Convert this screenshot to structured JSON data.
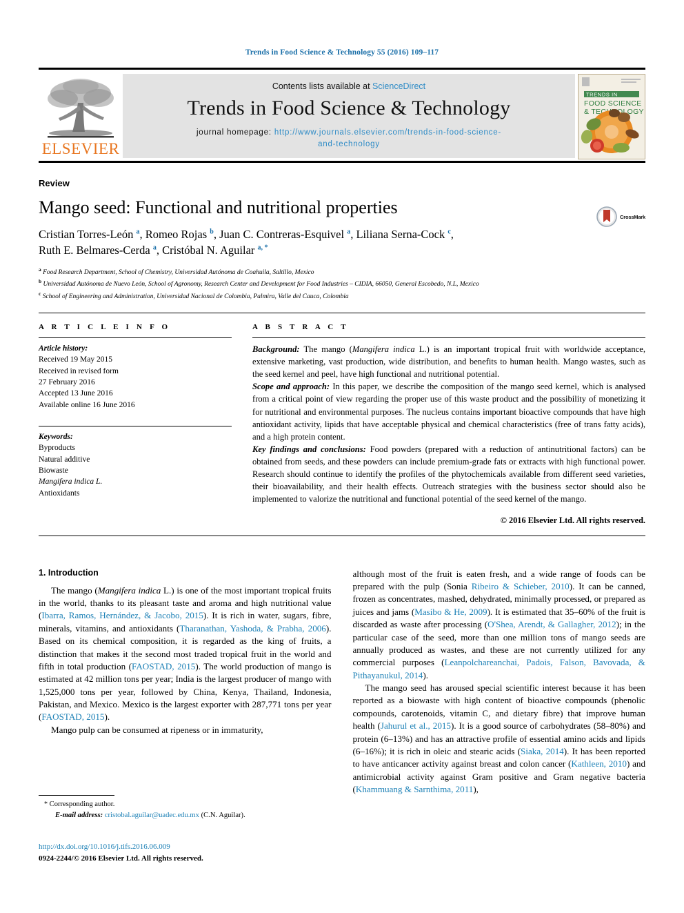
{
  "running_head": "Trends in Food Science & Technology 55 (2016) 109–117",
  "masthead": {
    "contents_prefix": "Contents lists available at ",
    "sciencedirect_link": "ScienceDirect",
    "journal_title": "Trends in Food Science & Technology",
    "homepage_label": "journal homepage: ",
    "homepage_url_line1": "http://www.journals.elsevier.com/trends-in-food-science-",
    "homepage_url_line2": "and-technology",
    "publisher_logo_text": "ELSEVIER",
    "cover_title_line1": "TRENDS IN",
    "cover_title_line2": "FOOD SCIENCE",
    "cover_title_line3": "& TECHNOLOGY",
    "link_color": "#2e8bc6"
  },
  "article": {
    "doctype": "Review",
    "title": "Mango seed: Functional and nutritional properties",
    "crossmark_label": "CrossMark",
    "authors_line1": "Cristian Torres-León a, Romeo Rojas b, Juan C. Contreras-Esquivel a, Liliana Serna-Cock c,",
    "authors_line2": "Ruth E. Belmares-Cerda a, Cristóbal N. Aguilar a, *",
    "authors": [
      {
        "name": "Cristian Torres-León",
        "sup": "a"
      },
      {
        "name": "Romeo Rojas",
        "sup": "b"
      },
      {
        "name": "Juan C. Contreras-Esquivel",
        "sup": "a"
      },
      {
        "name": "Liliana Serna-Cock",
        "sup": "c"
      },
      {
        "name": "Ruth E. Belmares-Cerda",
        "sup": "a"
      },
      {
        "name": "Cristóbal N. Aguilar",
        "sup": "a, *"
      }
    ],
    "affiliations": [
      {
        "sup": "a",
        "text": "Food Research Department, School of Chemistry, Universidad Autónoma de Coahuila, Saltillo, Mexico"
      },
      {
        "sup": "b",
        "text": "Universidad Autónoma de Nuevo León, School of Agronomy, Research Center and Development for Food Industries – CIDIA, 66050, General Escobedo, N.L, Mexico"
      },
      {
        "sup": "c",
        "text": "School of Engineering and Administration, Universidad Nacional de Colombia, Palmira, Valle del Cauca, Colombia"
      }
    ]
  },
  "article_info": {
    "heading": "A R T I C L E   I N F O",
    "history_label": "Article history:",
    "history": [
      "Received 19 May 2015",
      "Received in revised form",
      "27 February 2016",
      "Accepted 13 June 2016",
      "Available online 16 June 2016"
    ],
    "keywords_label": "Keywords:",
    "keywords": [
      "Byproducts",
      "Natural additive",
      "Biowaste",
      "Mangifera indica L.",
      "Antioxidants"
    ],
    "keyword_italic_index": 3
  },
  "abstract": {
    "heading": "A B S T R A C T",
    "background_label": "Background:",
    "background_text_a": " The mango (",
    "background_italic": "Mangifera indica",
    "background_text_b": " L.) is an important tropical fruit with worldwide acceptance, extensive marketing, vast production, wide distribution, and benefits to human health. Mango wastes, such as the seed kernel and peel, have high functional and nutritional potential.",
    "scope_label": "Scope and approach:",
    "scope_text": " In this paper, we describe the composition of the mango seed kernel, which is analysed from a critical point of view regarding the proper use of this waste product and the possibility of monetizing it for nutritional and environmental purposes. The nucleus contains important bioactive compounds that have high antioxidant activity, lipids that have acceptable physical and chemical characteristics (free of trans fatty acids), and a high protein content.",
    "findings_label": "Key findings and conclusions:",
    "findings_text": " Food powders (prepared with a reduction of antinutritional factors) can be obtained from seeds, and these powders can include premium-grade fats or extracts with high functional power. Research should continue to identify the profiles of the phytochemicals available from different seed varieties, their bioavailability, and their health effects. Outreach strategies with the business sector should also be implemented to valorize the nutritional and functional potential of the seed kernel of the mango.",
    "copyright": "© 2016 Elsevier Ltd. All rights reserved."
  },
  "body": {
    "section_number_title": "1. Introduction",
    "left": {
      "p1_a": "The mango (",
      "p1_italic": "Mangifera indica",
      "p1_b": " L.) is one of the most important tropical fruits in the world, thanks to its pleasant taste and aroma and high nutritional value (",
      "p1_ref1": "Ibarra, Ramos, Hernández, & Jacobo, 2015",
      "p1_c": "). It is rich in water, sugars, fibre, minerals, vitamins, and antioxidants (",
      "p1_ref2": "Tharanathan, Yashoda, & Prabha, 2006",
      "p1_d": "). Based on its chemical composition, it is regarded as the king of fruits, a distinction that makes it the second most traded tropical fruit in the world and fifth in total production (",
      "p1_ref3": "FAOSTAD, 2015",
      "p1_e": "). The world production of mango is estimated at 42 million tons per year; India is the largest producer of mango with 1,525,000 tons per year, followed by China, Kenya, Thailand, Indonesia, Pakistan, and Mexico. Mexico is the largest exporter with 287,771 tons per year (",
      "p1_ref4": "FAOSTAD, 2015",
      "p1_f": ").",
      "p2": "Mango pulp can be consumed at ripeness or in immaturity,"
    },
    "right": {
      "p1_a": "although most of the fruit is eaten fresh, and a wide range of foods can be prepared with the pulp (Sonia ",
      "p1_ref1": "Ribeiro & Schieber, 2010",
      "p1_b": "). It can be canned, frozen as concentrates, mashed, dehydrated, minimally processed, or prepared as juices and jams (",
      "p1_ref2": "Masibo & He, 2009",
      "p1_c": "). It is estimated that 35–60% of the fruit is discarded as waste after processing (",
      "p1_ref3": "O'Shea, Arendt, & Gallagher, 2012",
      "p1_d": "); in the particular case of the seed, more than one million tons of mango seeds are annually produced as wastes, and these are not currently utilized for any commercial purposes (",
      "p1_ref4": "Leanpolchareanchai, Padois, Falson, Bavovada, & Pithayanukul, 2014",
      "p1_e": ").",
      "p2_a": "The mango seed has aroused special scientific interest because it has been reported as a biowaste with high content of bioactive compounds (phenolic compounds, carotenoids, vitamin C, and dietary fibre) that improve human health (",
      "p2_ref1": "Jahurul et al., 2015",
      "p2_b": "). It is a good source of carbohydrates (58–80%) and protein (6–13%) and has an attractive profile of essential amino acids and lipids (6–16%); it is rich in oleic and stearic acids (",
      "p2_ref2": "Siaka, 2014",
      "p2_c": "). It has been reported to have anticancer activity against breast and colon cancer (",
      "p2_ref3": "Kathleen, 2010",
      "p2_d": ") and antimicrobial activity against Gram positive and Gram negative bacteria (",
      "p2_ref4": "Khammuang & Sarnthima, 2011",
      "p2_e": "),"
    }
  },
  "footer": {
    "corresponding_star": "*",
    "corresponding_text": "Corresponding author.",
    "email_label": "E-mail address:",
    "email": "cristobal.aguilar@uadec.edu.mx",
    "email_suffix": " (C.N. Aguilar).",
    "doi": "http://dx.doi.org/10.1016/j.tifs.2016.06.009",
    "issn_line": "0924-2244/© 2016 Elsevier Ltd. All rights reserved."
  }
}
